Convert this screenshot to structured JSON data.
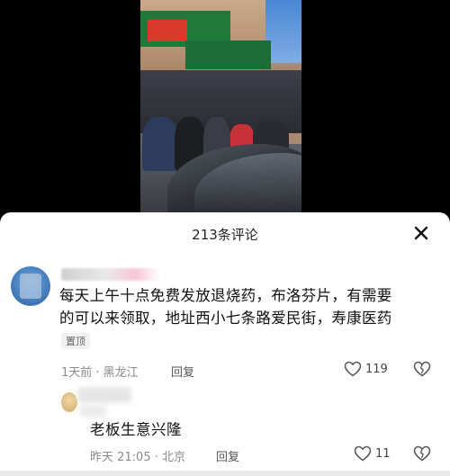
{
  "video": {
    "caption": ""
  },
  "comments_panel": {
    "title": "213条评论",
    "close_icon": "close-icon"
  },
  "comment": {
    "username": "",
    "text_line1": "每天上午十点免费发放退烧药，布洛芬片，有需要",
    "text_line2": "的可以来领取，地址西小七条路爱民街，寿康医药",
    "pin_label": "置顶",
    "time_location": "1天前 · 黑龙江",
    "reply_label": "回复",
    "like_count": "119"
  },
  "reply": {
    "username": "",
    "text": "老板生意兴隆",
    "time_location": "昨天 21:05 · 北京",
    "reply_label": "回复",
    "like_count": "11"
  },
  "colors": {
    "panel_bg": "#ffffff",
    "text_main": "#111111",
    "text_meta": "#8a8a8a",
    "caption_red": "#ff2a2a"
  }
}
